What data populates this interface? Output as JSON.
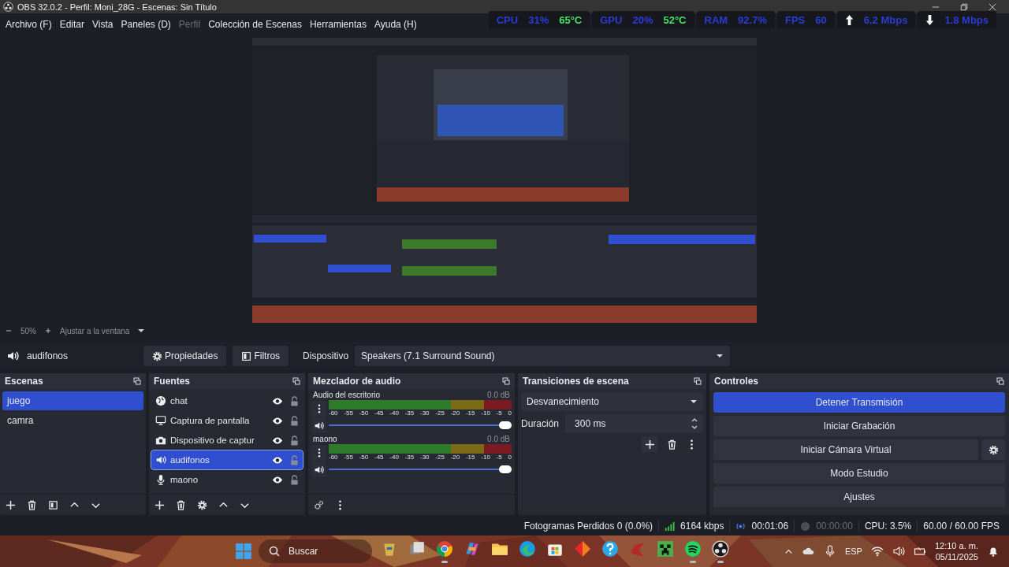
{
  "window": {
    "title": "OBS 32.0.2 - Perfil: Moni_28G - Escenas: Sin Título"
  },
  "menu": [
    {
      "label": "Archivo (F)",
      "disabled": false
    },
    {
      "label": "Editar",
      "disabled": false
    },
    {
      "label": "Vista",
      "disabled": false
    },
    {
      "label": "Paneles (D)",
      "disabled": false
    },
    {
      "label": "Perfil",
      "disabled": true
    },
    {
      "label": "Colección de Escenas",
      "disabled": false
    },
    {
      "label": "Herramientas",
      "disabled": false
    },
    {
      "label": "Ayuda (H)",
      "disabled": false
    }
  ],
  "stats": [
    {
      "kind": "plain",
      "items": [
        {
          "text": "CPU",
          "kind": "value"
        },
        {
          "text": "31%",
          "kind": "value"
        },
        {
          "text": "65°C",
          "kind": "temp"
        }
      ]
    },
    {
      "kind": "plain",
      "items": [
        {
          "text": "GPU",
          "kind": "value"
        },
        {
          "text": "20%",
          "kind": "value"
        },
        {
          "text": "52°C",
          "kind": "temp"
        }
      ]
    },
    {
      "kind": "plain",
      "items": [
        {
          "text": "RAM",
          "kind": "value"
        },
        {
          "text": "92.7%",
          "kind": "value"
        }
      ]
    },
    {
      "kind": "plain",
      "items": [
        {
          "text": "FPS",
          "kind": "value"
        },
        {
          "text": "60",
          "kind": "value"
        }
      ]
    },
    {
      "kind": "up",
      "items": [
        {
          "text": "6.2 Mbps",
          "kind": "value"
        }
      ]
    },
    {
      "kind": "down",
      "items": [
        {
          "text": "1.8 Mbps",
          "kind": "value"
        }
      ]
    }
  ],
  "zoom_bar": {
    "zoom": "50%",
    "fit": "Ajustar a la ventana"
  },
  "source_bar": {
    "name": "audifonos",
    "buttons": [
      {
        "label": "Propiedades",
        "kind": "gear"
      },
      {
        "label": "Filtros",
        "kind": "filter"
      }
    ],
    "device_label": "Dispositivo",
    "device": "Speakers (7.1 Surround Sound)"
  },
  "scenes": {
    "title": "Escenas",
    "items": [
      {
        "label": "juego",
        "selected": true
      },
      {
        "label": "camra",
        "selected": false
      }
    ]
  },
  "sources": {
    "title": "Fuentes",
    "items": [
      {
        "label": "chat",
        "kind": "browser",
        "selected": false,
        "visible": true,
        "locked": false
      },
      {
        "label": "Captura de pantalla",
        "kind": "display",
        "selected": false,
        "visible": true,
        "locked": false
      },
      {
        "label": "Dispositivo de captur",
        "kind": "camera",
        "selected": false,
        "visible": true,
        "locked": false
      },
      {
        "label": "audifonos",
        "kind": "speaker",
        "selected": true,
        "visible": true,
        "locked": false
      },
      {
        "label": "maono",
        "kind": "mic",
        "selected": false,
        "visible": true,
        "locked": false
      }
    ]
  },
  "mixer": {
    "title": "Mezclador de audio",
    "channels": [
      {
        "name": "Audio del escritorio",
        "reading": "0.0 dB",
        "level": 1,
        "scale": [
          "-60",
          "-55",
          "-50",
          "-45",
          "-40",
          "-35",
          "-30",
          "-25",
          "-20",
          "-15",
          "-10",
          "-5",
          "0"
        ]
      },
      {
        "name": "maono",
        "reading": "0.0 dB",
        "level": 1,
        "scale": [
          "-60",
          "-55",
          "-50",
          "-45",
          "-40",
          "-35",
          "-30",
          "-25",
          "-20",
          "-15",
          "-10",
          "-5",
          "0"
        ]
      }
    ]
  },
  "transitions": {
    "title": "Transiciones de escena",
    "transition": "Desvanecimiento",
    "duration_label": "Duración",
    "duration": "300 ms"
  },
  "controls": {
    "title": "Controles",
    "buttons": [
      {
        "label": "Detener Transmisión",
        "active": true,
        "settings": false
      },
      {
        "label": "Iniciar Grabación",
        "active": false,
        "settings": false
      },
      {
        "label": "Iniciar Cámara Virtual",
        "active": false,
        "settings": true
      },
      {
        "label": "Modo Estudio",
        "active": false,
        "settings": false
      },
      {
        "label": "Ajustes",
        "active": false,
        "settings": false
      }
    ]
  },
  "status_bar": {
    "dropped": "Fotogramas Perdidos 0 (0.0%)",
    "bitrate": "6164 kbps",
    "stream_time": "00:01:06",
    "record_time": "00:00:00",
    "cpu": "CPU: 3.5%",
    "fps": "60.00 / 60.00 FPS"
  },
  "taskbar": {
    "search": "Buscar",
    "apps": [
      {
        "kind": "widget",
        "running": false
      },
      {
        "kind": "taskview",
        "running": false
      },
      {
        "kind": "chrome",
        "running": true
      },
      {
        "kind": "copilot",
        "running": false
      },
      {
        "kind": "folder",
        "running": false
      },
      {
        "kind": "edge",
        "running": false
      },
      {
        "kind": "store",
        "running": false
      },
      {
        "kind": "diamond",
        "running": false
      },
      {
        "kind": "help",
        "running": false
      },
      {
        "kind": "redapp",
        "running": false
      },
      {
        "kind": "creeper",
        "running": false
      },
      {
        "kind": "spotify",
        "running": true
      },
      {
        "kind": "obs",
        "running": true
      }
    ],
    "language": "ESP",
    "time": "12:10 a. m.",
    "date": "05/11/2025"
  }
}
